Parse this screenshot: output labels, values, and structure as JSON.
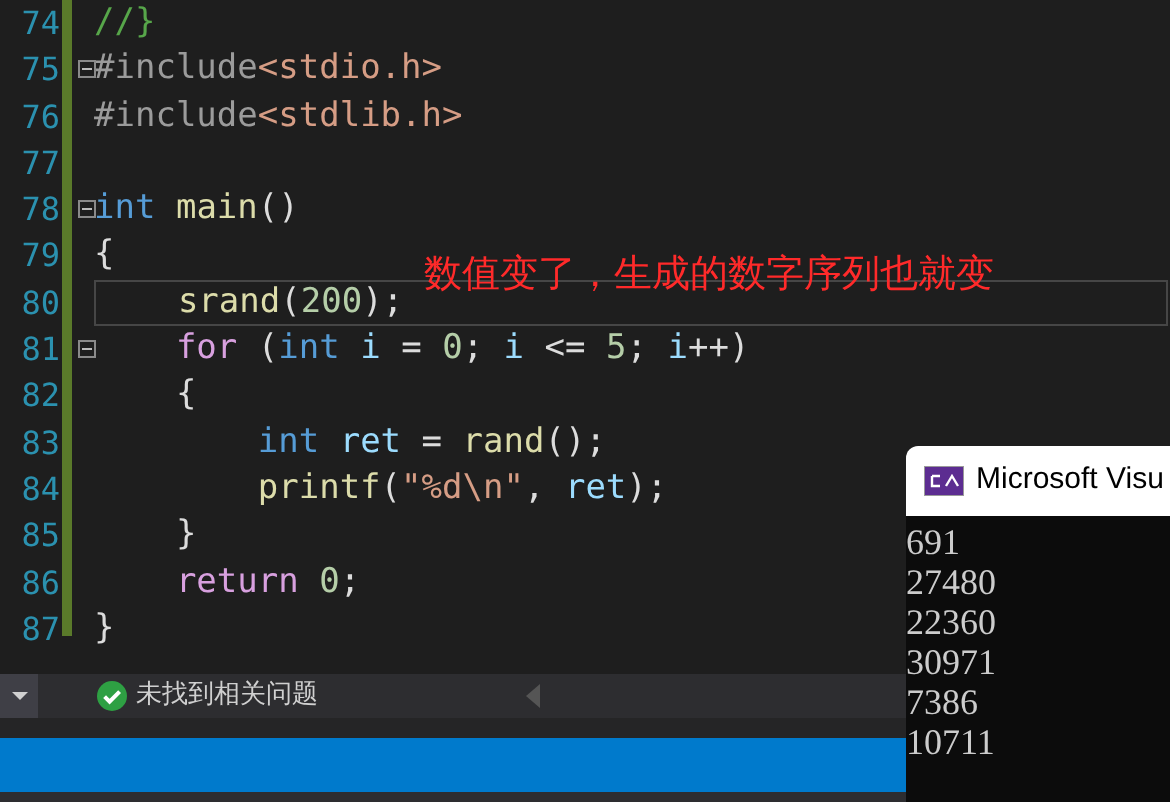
{
  "editor": {
    "lines": [
      {
        "number": "74",
        "fold": false,
        "tokens": [
          {
            "kind": "comment",
            "text": "//}"
          }
        ]
      },
      {
        "number": "75",
        "fold": true,
        "tokens": [
          {
            "kind": "preproc",
            "text": "#include"
          },
          {
            "kind": "header",
            "text": "<stdio.h>"
          }
        ]
      },
      {
        "number": "76",
        "fold": false,
        "tokens": [
          {
            "kind": "preproc",
            "text": "#include"
          },
          {
            "kind": "header",
            "text": "<stdlib.h>"
          }
        ]
      },
      {
        "number": "77",
        "fold": false
      },
      {
        "number": "78",
        "fold": true,
        "tokens": [
          {
            "kind": "keyword",
            "text": "int "
          },
          {
            "kind": "function",
            "text": "main"
          },
          {
            "kind": "punct",
            "text": "()"
          }
        ]
      },
      {
        "number": "79",
        "fold": false,
        "tokens": [
          {
            "kind": "punct",
            "text": "{"
          }
        ]
      },
      {
        "number": "80",
        "fold": false,
        "current": true,
        "tokens": [
          {
            "kind": "function",
            "text": "    srand"
          },
          {
            "kind": "punct",
            "text": "("
          },
          {
            "kind": "number",
            "text": "200"
          },
          {
            "kind": "punct",
            "text": ");"
          }
        ]
      },
      {
        "number": "81",
        "fold": true,
        "tokens": [
          {
            "kind": "control",
            "text": "    for"
          },
          {
            "kind": "punct",
            "text": " ("
          },
          {
            "kind": "keyword",
            "text": "int "
          },
          {
            "kind": "variable",
            "text": "i"
          },
          {
            "kind": "punct",
            "text": " = "
          },
          {
            "kind": "number",
            "text": "0"
          },
          {
            "kind": "punct",
            "text": "; "
          },
          {
            "kind": "variable",
            "text": "i"
          },
          {
            "kind": "punct",
            "text": " <= "
          },
          {
            "kind": "number",
            "text": "5"
          },
          {
            "kind": "punct",
            "text": "; "
          },
          {
            "kind": "variable",
            "text": "i"
          },
          {
            "kind": "punct",
            "text": "++)"
          }
        ]
      },
      {
        "number": "82",
        "fold": false,
        "tokens": [
          {
            "kind": "punct",
            "text": "    {"
          }
        ]
      },
      {
        "number": "83",
        "fold": false,
        "tokens": [
          {
            "kind": "keyword",
            "text": "        int "
          },
          {
            "kind": "variable",
            "text": "ret"
          },
          {
            "kind": "punct",
            "text": " = "
          },
          {
            "kind": "function",
            "text": "rand"
          },
          {
            "kind": "punct",
            "text": "();"
          }
        ]
      },
      {
        "number": "84",
        "fold": false,
        "tokens": [
          {
            "kind": "function",
            "text": "        printf"
          },
          {
            "kind": "punct",
            "text": "("
          },
          {
            "kind": "string",
            "text": "\"%d\\n\""
          },
          {
            "kind": "punct",
            "text": ", "
          },
          {
            "kind": "variable",
            "text": "ret"
          },
          {
            "kind": "punct",
            "text": ");"
          }
        ]
      },
      {
        "number": "85",
        "fold": false,
        "tokens": [
          {
            "kind": "punct",
            "text": "    }"
          }
        ]
      },
      {
        "number": "86",
        "fold": false,
        "tokens": [
          {
            "kind": "control",
            "text": "    return "
          },
          {
            "kind": "number",
            "text": "0"
          },
          {
            "kind": "punct",
            "text": ";"
          }
        ]
      },
      {
        "number": "87",
        "fold": false,
        "tokens": [
          {
            "kind": "punct",
            "text": "}"
          }
        ]
      }
    ]
  },
  "annotation": "数值变了，生成的数字序列也就变",
  "status": {
    "message": "未找到相关问题"
  },
  "console": {
    "title": "Microsoft Visu",
    "output": [
      "691",
      "27480",
      "22360",
      "30971",
      "7386",
      "10711"
    ]
  }
}
